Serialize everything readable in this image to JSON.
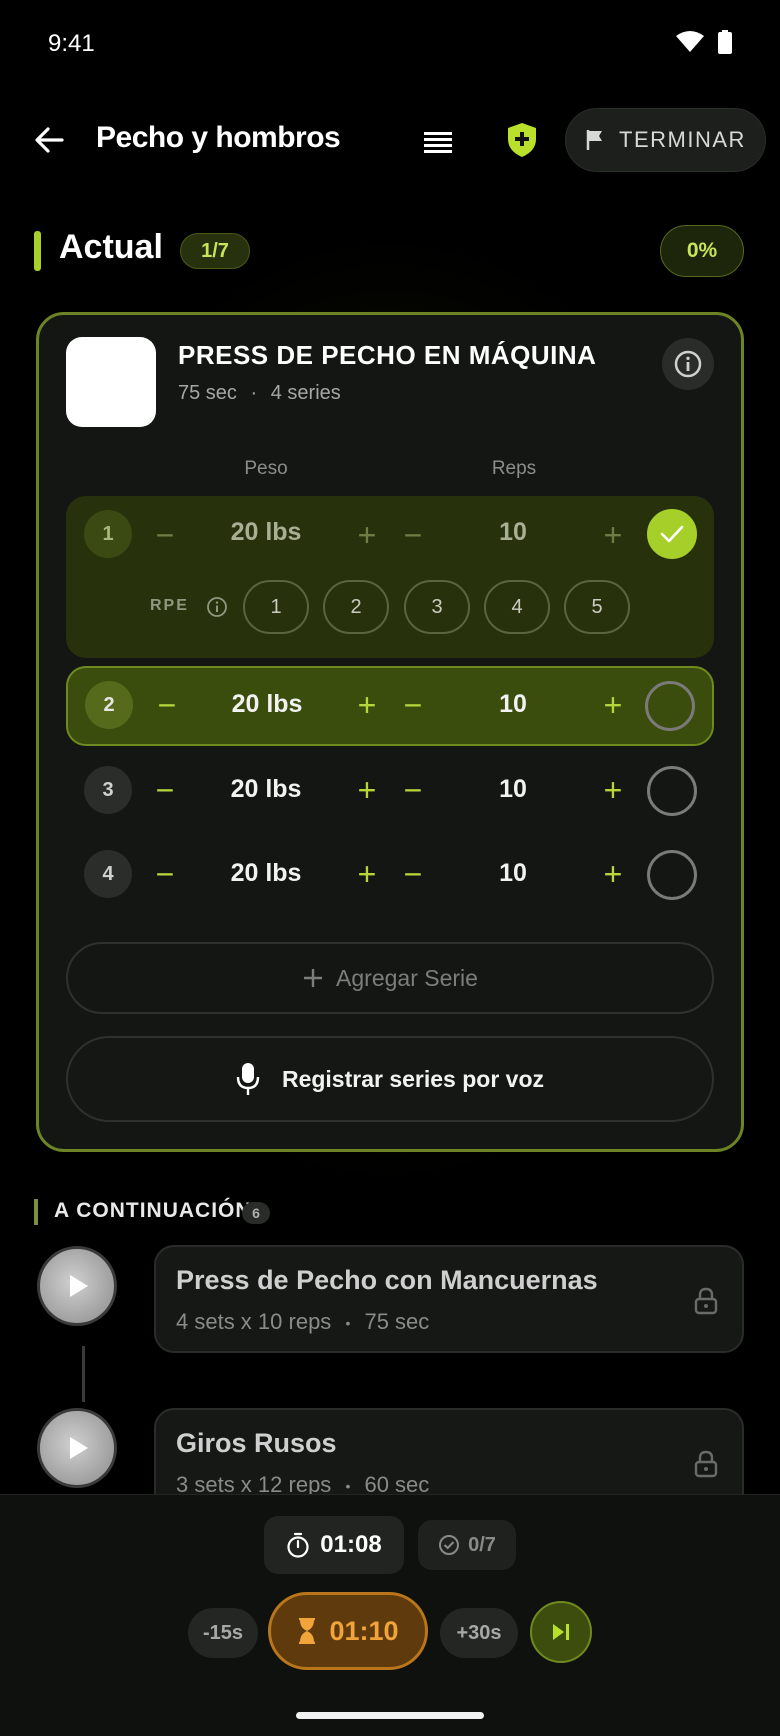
{
  "status_bar": {
    "time": "9:41"
  },
  "header": {
    "title": "Pecho y hombros",
    "finish_label": "TERMINAR"
  },
  "current": {
    "title": "Actual",
    "count": "1/7",
    "percent": "0%"
  },
  "exercise": {
    "name": "PRESS DE PECHO EN MÁQUINA",
    "rest": "75 sec",
    "separator": "·",
    "series": "4 series",
    "col_weight": "Peso",
    "col_reps": "Reps",
    "sets": [
      {
        "num": "1",
        "weight": "20 lbs",
        "reps": "10",
        "completed": true
      },
      {
        "num": "2",
        "weight": "20 lbs",
        "reps": "10",
        "completed": false,
        "active": true
      },
      {
        "num": "3",
        "weight": "20 lbs",
        "reps": "10",
        "completed": false
      },
      {
        "num": "4",
        "weight": "20 lbs",
        "reps": "10",
        "completed": false
      }
    ],
    "rpe_label": "RPE",
    "rpe_options": [
      "1",
      "2",
      "3",
      "4",
      "5"
    ],
    "add_set_label": "Agregar Serie",
    "voice_label": "Registrar series por voz"
  },
  "next": {
    "title": "A CONTINUACIÓN",
    "count": "6",
    "items": [
      {
        "name": "Press de Pecho con Mancuernas",
        "sets_reps": "4 sets x 10 reps",
        "separator": "•",
        "rest": "75 sec"
      },
      {
        "name": "Giros Rusos",
        "sets_reps": "3 sets x 12 reps",
        "separator": "•",
        "rest": "60 sec"
      }
    ]
  },
  "bottom": {
    "elapsed": "01:08",
    "sets_done": "0/7",
    "minus_label": "-15s",
    "rest_timer": "01:10",
    "plus_label": "+30s"
  },
  "colors": {
    "accent": "#a7cf2a",
    "rest_orange": "#f1a43a",
    "background": "#000000"
  }
}
